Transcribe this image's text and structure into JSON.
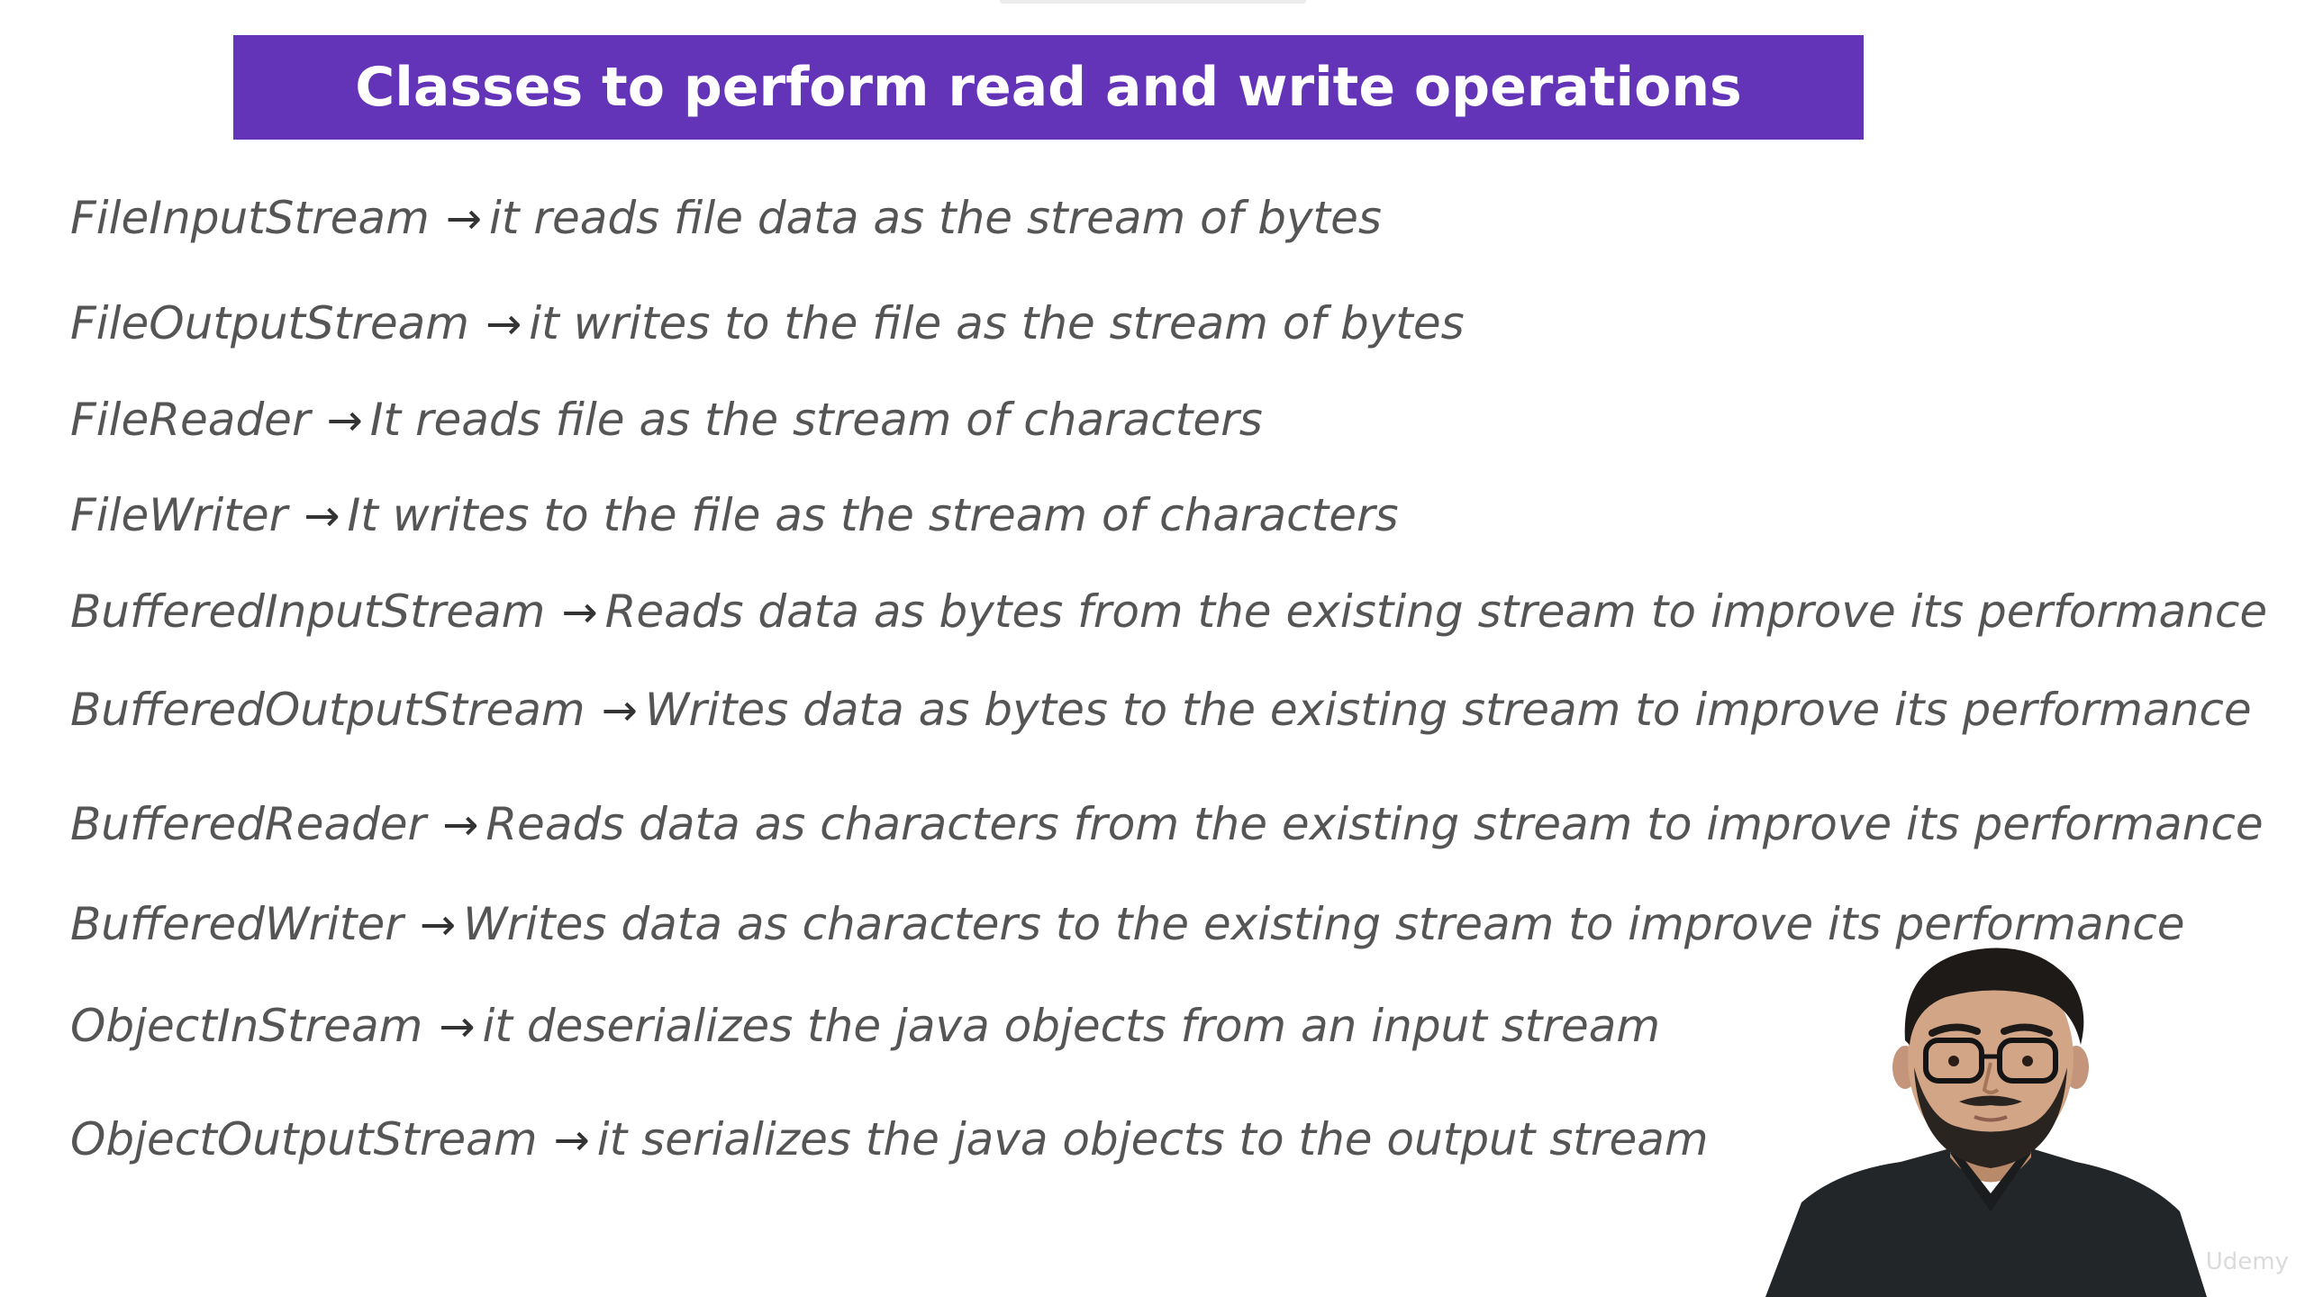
{
  "slide": {
    "title": "Classes to perform read and write operations",
    "arrow_glyph": "→",
    "items": [
      {
        "class_name": "FileInputStream",
        "description": "it reads file data as the stream of bytes"
      },
      {
        "class_name": "FileOutputStream",
        "description": "it writes to the file as the stream of bytes"
      },
      {
        "class_name": "FileReader",
        "description": "It reads file as the stream of characters"
      },
      {
        "class_name": "FileWriter",
        "description": "It writes to the file as the stream of characters"
      },
      {
        "class_name": "BufferedInputStream",
        "description": "Reads data as bytes from the existing stream to improve its performance"
      },
      {
        "class_name": "BufferedOutputStream",
        "description": "Writes data as bytes to the existing stream to improve its performance"
      },
      {
        "class_name": "BufferedReader",
        "description": "Reads data as characters from the existing stream to improve its performance"
      },
      {
        "class_name": "BufferedWriter",
        "description": "Writes data as characters to the existing stream to improve its performance"
      },
      {
        "class_name": "ObjectInStream",
        "description": "it deserializes the java objects from an input stream"
      },
      {
        "class_name": "ObjectOutputStream",
        "description": "it serializes the java objects to the output stream"
      }
    ]
  },
  "watermark": {
    "text": "Udemy"
  },
  "colors": {
    "banner": "#6333b8",
    "banner_text": "#ffffff",
    "body_text": "#555555"
  },
  "icons": {
    "arrow": "right-arrow-icon",
    "presenter": "presenter-video-overlay"
  }
}
